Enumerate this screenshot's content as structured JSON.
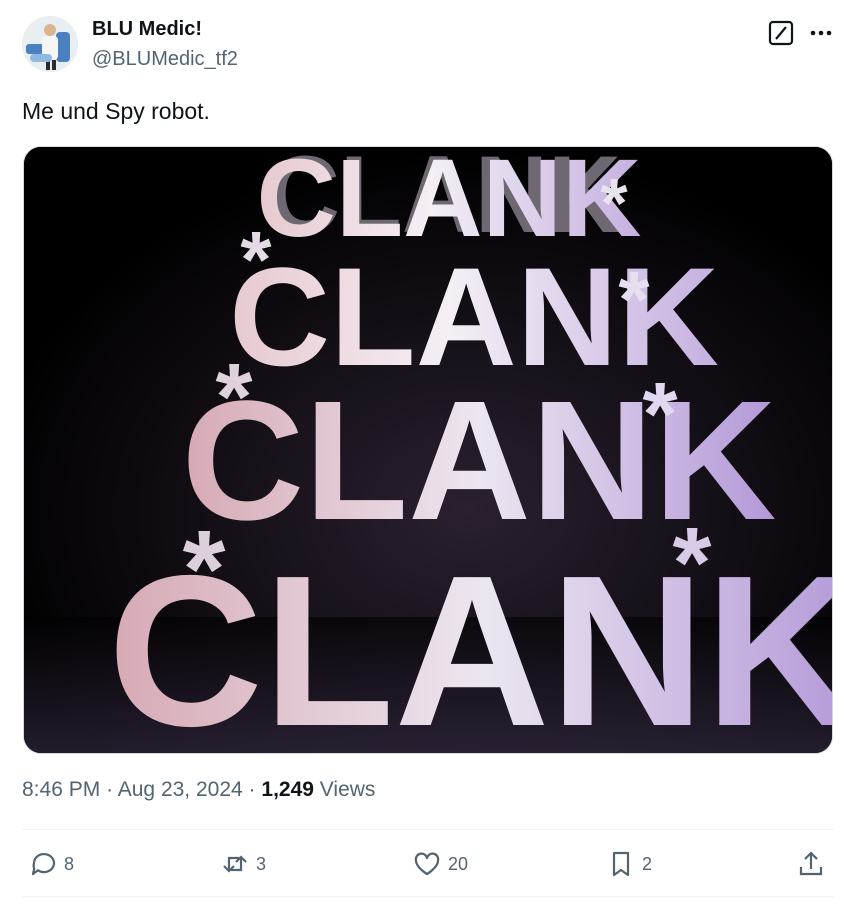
{
  "post": {
    "author_name": "BLU Medic!",
    "author_handle": "@BLUMedic_tf2",
    "text": "Me und Spy robot."
  },
  "media": {
    "words": [
      "CLANK",
      "CLANK",
      "CLANK",
      "CLANK",
      "CLANK"
    ],
    "asterisk": "*",
    "colors": {
      "background": "#000000",
      "text_light": "#f3eef6",
      "text_pink": "#d9a9b3",
      "text_purple": "#b59ad6"
    }
  },
  "meta": {
    "time": "8:46 PM",
    "separator": "·",
    "date": "Aug 23, 2024",
    "views_count": "1,249",
    "views_label": "Views"
  },
  "actions": {
    "replies": "8",
    "reposts": "3",
    "likes": "20",
    "bookmarks": "2"
  },
  "icons": [
    "grok-icon",
    "more-icon",
    "reply-icon",
    "repost-icon",
    "like-icon",
    "bookmark-icon",
    "share-icon"
  ],
  "colors": {
    "text": "#0f1419",
    "secondary": "#536471",
    "divider": "#eff3f4"
  }
}
